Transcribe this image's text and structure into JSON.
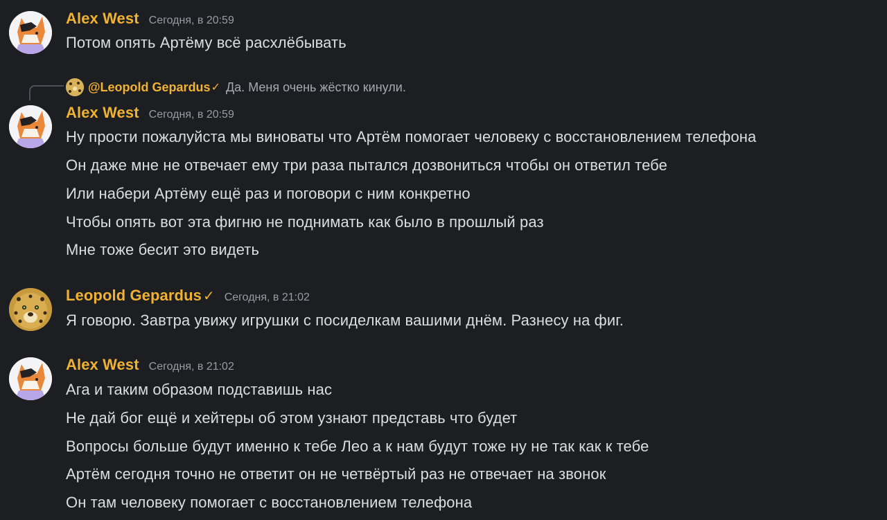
{
  "messages": [
    {
      "author": "Alex West",
      "timestamp": "Сегодня, в 20:59",
      "lines": [
        "Потом опять Артёму всё расхлёбывать"
      ]
    },
    {
      "reply": {
        "mention": "@Leopold Gepardus",
        "check": "✓",
        "text": "Да. Меня очень жёстко кинули."
      },
      "author": "Alex West",
      "timestamp": "Сегодня, в 20:59",
      "lines": [
        "Ну прости пожалуйста мы виноваты что Артём помогает человеку с восстановлением телефона",
        "Он даже мне не отвечает ему три раза пытался дозвониться чтобы он ответил тебе",
        "Или набери Артёму ещё раз и поговори с ним конкретно",
        "Чтобы опять вот эта фигню не поднимать как было в прошлый раз",
        "Мне тоже бесит это видеть"
      ]
    },
    {
      "author": "Leopold Gepardus",
      "check": "✓",
      "timestamp": "Сегодня, в 21:02",
      "lines": [
        "Я говорю. Завтра увижу игрушки с посиделкам вашими днём. Разнесу на фиг."
      ]
    },
    {
      "author": "Alex West",
      "timestamp": "Сегодня, в 21:02",
      "lines": [
        "Ага и таким образом подставишь нас",
        "Не дай бог ещё и хейтеры об этом узнают представь что будет",
        "Вопросы больше будут именно к тебе Лео а к нам будут тоже ну не так как к тебе",
        "Артём сегодня точно не ответит он не четвёртый раз не отвечает на звонок",
        "Он там человеку помогает с восстановлением телефона"
      ]
    }
  ],
  "colors": {
    "background": "#1d1e21",
    "author": "#f0b232",
    "text": "#dcdde1",
    "timestamp": "#9a9ca3",
    "reply_text": "#a7a9b0"
  },
  "icons": {
    "alex_avatar": "fox-avatar-icon",
    "leopold_avatar": "leopard-avatar-icon"
  }
}
